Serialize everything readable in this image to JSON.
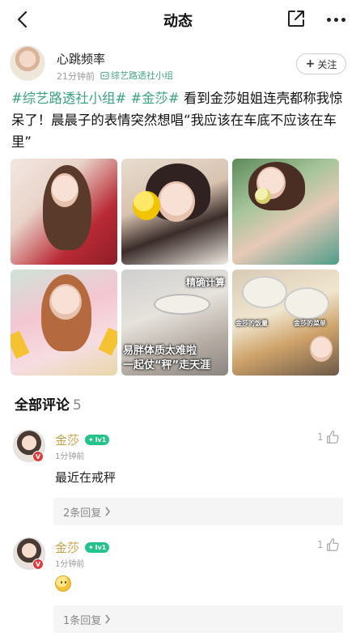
{
  "header": {
    "title": "动态"
  },
  "post": {
    "author": {
      "name": "心跳频率",
      "time": "21分钟前",
      "group": "综艺路透社小组",
      "follow_label": "关注"
    },
    "text": {
      "tag1": "#综艺路透社小组#",
      "tag2": "#金莎#",
      "body": "看到金莎姐姐连壳都称我惊呆了！晨晨子的表情突然想唱“我应该在车底不应该在车里”"
    },
    "images": [
      {
        "caption": ""
      },
      {
        "caption": ""
      },
      {
        "caption": ""
      },
      {
        "caption": ""
      },
      {
        "caption_top": "精确计算",
        "caption_line1": "易胖体质太难啦",
        "caption_line2": "一起仗“秤”走天涯"
      },
      {
        "caption_left": "金莎的饭量",
        "caption_right": "金莎的菜单"
      }
    ]
  },
  "comments": {
    "title": "全部评论",
    "count": "5",
    "items": [
      {
        "name": "金莎",
        "level": "lv1",
        "time": "1分钟前",
        "text": "最近在戒秤",
        "likes": "1",
        "replies": "2条回复"
      },
      {
        "name": "金莎",
        "level": "lv1",
        "time": "1分钟前",
        "text": "",
        "emoji": "smiley-emoji",
        "likes": "1",
        "replies": "1条回复"
      }
    ]
  },
  "colors": {
    "tag_green": "#3aa383",
    "name_gold": "#c8a24a",
    "level_green": "#26c28b",
    "verified_red": "#e23b3b"
  }
}
